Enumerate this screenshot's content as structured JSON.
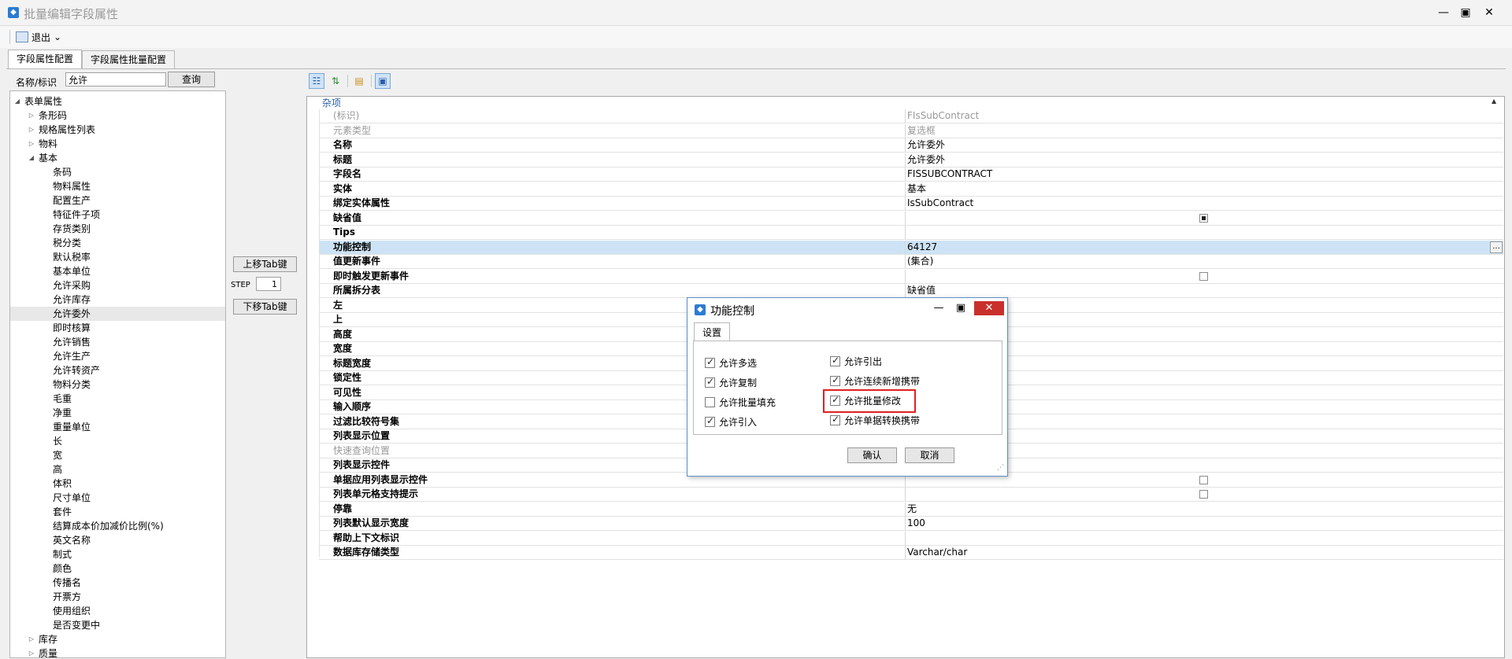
{
  "window": {
    "title": "批量编辑字段属性",
    "min_icon": "minimize-icon",
    "max_icon": "maximize-icon",
    "close_icon": "close-icon"
  },
  "toolbar": {
    "exit_label": "退出",
    "exit_arrow": "⌄"
  },
  "tabs": [
    {
      "label": "字段属性配置",
      "active": true
    },
    {
      "label": "字段属性批量配置",
      "active": false
    }
  ],
  "search": {
    "label": "名称/标识",
    "value": "允许",
    "button": "查询"
  },
  "tree": [
    {
      "label": "表单属性",
      "level": 0,
      "arrow": "◢"
    },
    {
      "label": "条形码",
      "level": 1,
      "arrow": "▷"
    },
    {
      "label": "规格属性列表",
      "level": 1,
      "arrow": "▷"
    },
    {
      "label": "物料",
      "level": 1,
      "arrow": "▷"
    },
    {
      "label": "基本",
      "level": 1,
      "arrow": "◢"
    },
    {
      "label": "条码",
      "level": 2
    },
    {
      "label": "物料属性",
      "level": 2
    },
    {
      "label": "配置生产",
      "level": 2
    },
    {
      "label": "特征件子项",
      "level": 2
    },
    {
      "label": "存货类别",
      "level": 2
    },
    {
      "label": "税分类",
      "level": 2
    },
    {
      "label": "默认税率",
      "level": 2
    },
    {
      "label": "基本单位",
      "level": 2
    },
    {
      "label": "允许采购",
      "level": 2
    },
    {
      "label": "允许库存",
      "level": 2
    },
    {
      "label": "允许委外",
      "level": 2,
      "selected": true
    },
    {
      "label": "即时核算",
      "level": 2
    },
    {
      "label": "允许销售",
      "level": 2
    },
    {
      "label": "允许生产",
      "level": 2
    },
    {
      "label": "允许转资产",
      "level": 2
    },
    {
      "label": "物料分类",
      "level": 2
    },
    {
      "label": "毛重",
      "level": 2
    },
    {
      "label": "净重",
      "level": 2
    },
    {
      "label": "重量单位",
      "level": 2
    },
    {
      "label": "长",
      "level": 2
    },
    {
      "label": "宽",
      "level": 2
    },
    {
      "label": "高",
      "level": 2
    },
    {
      "label": "体积",
      "level": 2
    },
    {
      "label": "尺寸单位",
      "level": 2
    },
    {
      "label": "套件",
      "level": 2
    },
    {
      "label": "结算成本价加减价比例(%)",
      "level": 2
    },
    {
      "label": "英文名称",
      "level": 2
    },
    {
      "label": "制式",
      "level": 2
    },
    {
      "label": "颜色",
      "level": 2
    },
    {
      "label": "传播名",
      "level": 2
    },
    {
      "label": "开票方",
      "level": 2
    },
    {
      "label": "使用组织",
      "level": 2
    },
    {
      "label": "是否变更中",
      "level": 2
    },
    {
      "label": "库存",
      "level": 1,
      "arrow": "▷"
    },
    {
      "label": "质量",
      "level": 1,
      "arrow": "▷"
    }
  ],
  "mid": {
    "up_label": "上移Tab键",
    "step_label": "STEP",
    "step_value": "1",
    "down_label": "下移Tab键"
  },
  "prop_toolbar": [
    {
      "icon": "categorized-icon",
      "glyph": "☷",
      "active": true
    },
    {
      "icon": "sort-alpha-icon",
      "glyph": "⇅",
      "active": false
    },
    {
      "icon": "properties-icon",
      "glyph": "▤",
      "active": false
    },
    {
      "icon": "property-pages-icon",
      "glyph": "▣",
      "active": true
    }
  ],
  "grid": {
    "category": "杂项",
    "collapse_glyph": "▲",
    "rows": [
      {
        "name": "(标识)",
        "value": "FIsSubContract",
        "dim": true
      },
      {
        "name": "元素类型",
        "value": "复选框",
        "dim": true
      },
      {
        "name": "名称",
        "value": "允许委外"
      },
      {
        "name": "标题",
        "value": "允许委外"
      },
      {
        "name": "字段名",
        "value": "FISSUBCONTRACT"
      },
      {
        "name": "实体",
        "value": "基本"
      },
      {
        "name": "绑定实体属性",
        "value": "IsSubContract"
      },
      {
        "name": "缺省值",
        "value": "",
        "check": true,
        "checked": true
      },
      {
        "name": "Tips",
        "value": ""
      },
      {
        "name": "功能控制",
        "value": "64127",
        "selected": true,
        "ellipsis": "..."
      },
      {
        "name": "值更新事件",
        "value": "(集合)"
      },
      {
        "name": "即时触发更新事件",
        "value": "",
        "check": true,
        "checked": false
      },
      {
        "name": "所属拆分表",
        "value": "缺省值"
      },
      {
        "name": "左",
        "value": ""
      },
      {
        "name": "上",
        "value": ""
      },
      {
        "name": "高度",
        "value": ""
      },
      {
        "name": "宽度",
        "value": ""
      },
      {
        "name": "标题宽度",
        "value": ""
      },
      {
        "name": "锁定性",
        "value": ""
      },
      {
        "name": "可见性",
        "value": ""
      },
      {
        "name": "输入顺序",
        "value": ""
      },
      {
        "name": "过滤比较符号集",
        "value": ""
      },
      {
        "name": "列表显示位置",
        "value": ""
      },
      {
        "name": "快速查询位置",
        "value": "",
        "dim": true
      },
      {
        "name": "列表显示控件",
        "value": ""
      },
      {
        "name": "单据应用列表显示控件",
        "value": "",
        "check": true,
        "checked": false
      },
      {
        "name": "列表单元格支持提示",
        "value": "",
        "check": true,
        "checked": false
      },
      {
        "name": "停靠",
        "value": "无"
      },
      {
        "name": "列表默认显示宽度",
        "value": "100"
      },
      {
        "name": "帮助上下文标识",
        "value": ""
      },
      {
        "name": "数据库存储类型",
        "value": "Varchar/char"
      }
    ]
  },
  "dialog": {
    "title": "功能控制",
    "tab": "设置",
    "options": [
      {
        "label": "允许多选",
        "checked": true
      },
      {
        "label": "允许复制",
        "checked": true
      },
      {
        "label": "允许批量填充",
        "checked": false
      },
      {
        "label": "允许引入",
        "checked": true
      },
      {
        "label": "允许引出",
        "checked": true
      },
      {
        "label": "允许连续新增携带",
        "checked": true
      },
      {
        "label": "允许批量修改",
        "checked": true
      },
      {
        "label": "允许单据转换携带",
        "checked": true
      }
    ],
    "ok": "确认",
    "cancel": "取消",
    "highlight_color": "#e02020"
  },
  "colors": {
    "accent": "#2b7cd3",
    "selected_row": "#cde3f5",
    "close_red": "#c9302c"
  }
}
